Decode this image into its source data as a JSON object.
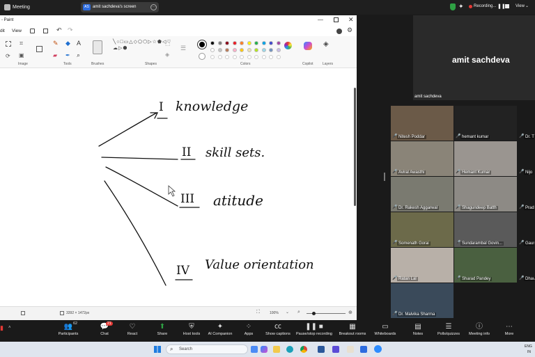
{
  "topbar": {
    "app_title": "Meeting",
    "share_badge": "AS",
    "share_label": "amit sachdeva's screen",
    "recording_label": "Recording...",
    "view_label": "View"
  },
  "paint": {
    "window_title": "- Paint",
    "menu": [
      "dit",
      "View"
    ],
    "group_labels": {
      "image": "Image",
      "tools": "Tools",
      "brushes": "Brushes",
      "shapes": "Shapes",
      "colors": "Colors",
      "copilot": "Copilot",
      "layers": "Layers"
    },
    "canvas_text": {
      "item1_num": "I",
      "item1": "knowledge",
      "item2_num": "II",
      "item2": "skill sets.",
      "item3_num": "III",
      "item3": "atitude",
      "item4_num": "IV",
      "item4": "Value orientation"
    },
    "status": {
      "dimensions": "3392 × 1472px",
      "zoom": "100%"
    }
  },
  "active_speaker": {
    "name": "amit sachdeva",
    "label": "amit sachdeva"
  },
  "participants": [
    {
      "name": "Nitesh Poddar"
    },
    {
      "name": "hemant kumar"
    },
    {
      "name": "Dr. T"
    },
    {
      "name": "Aviral Awasthi"
    },
    {
      "name": "Hemant Kumar"
    },
    {
      "name": "Nijo"
    },
    {
      "name": "Dr. Rakesh Aggarwal"
    },
    {
      "name": "Shagundeep Batth"
    },
    {
      "name": "Prad"
    },
    {
      "name": "Somenath Gorai"
    },
    {
      "name": "Sundarambal Govin..."
    },
    {
      "name": "Gaur"
    },
    {
      "name": "Ratan Lal"
    },
    {
      "name": "Sharad Pandey"
    },
    {
      "name": "Dhav"
    },
    {
      "name": "Dr. Malvika Sharma"
    }
  ],
  "toolbar": {
    "participants_count": "62",
    "chat_badge": "21",
    "buttons": [
      "Participants",
      "Chat",
      "React",
      "Share",
      "Host tools",
      "AI Companion",
      "Apps",
      "Show captions",
      "Pause/stop recording",
      "Breakout rooms",
      "Whiteboards",
      "Notes",
      "Polls/quizzes",
      "Meeting info",
      "More"
    ]
  },
  "taskbar": {
    "search_placeholder": "Search",
    "lang": "ENG",
    "region": "IN"
  },
  "palette": [
    "#000000",
    "#7f7f7f",
    "#880015",
    "#ed1c24",
    "#ff7f27",
    "#fff200",
    "#22b14c",
    "#00a2e8",
    "#3f48cc",
    "#a349a4",
    "#ffffff",
    "#c3c3c3",
    "#b97a57",
    "#ffaec9",
    "#ffc90e",
    "#efe4b0",
    "#b5e61d",
    "#99d9ea",
    "#7092be",
    "#c8bfe7"
  ]
}
